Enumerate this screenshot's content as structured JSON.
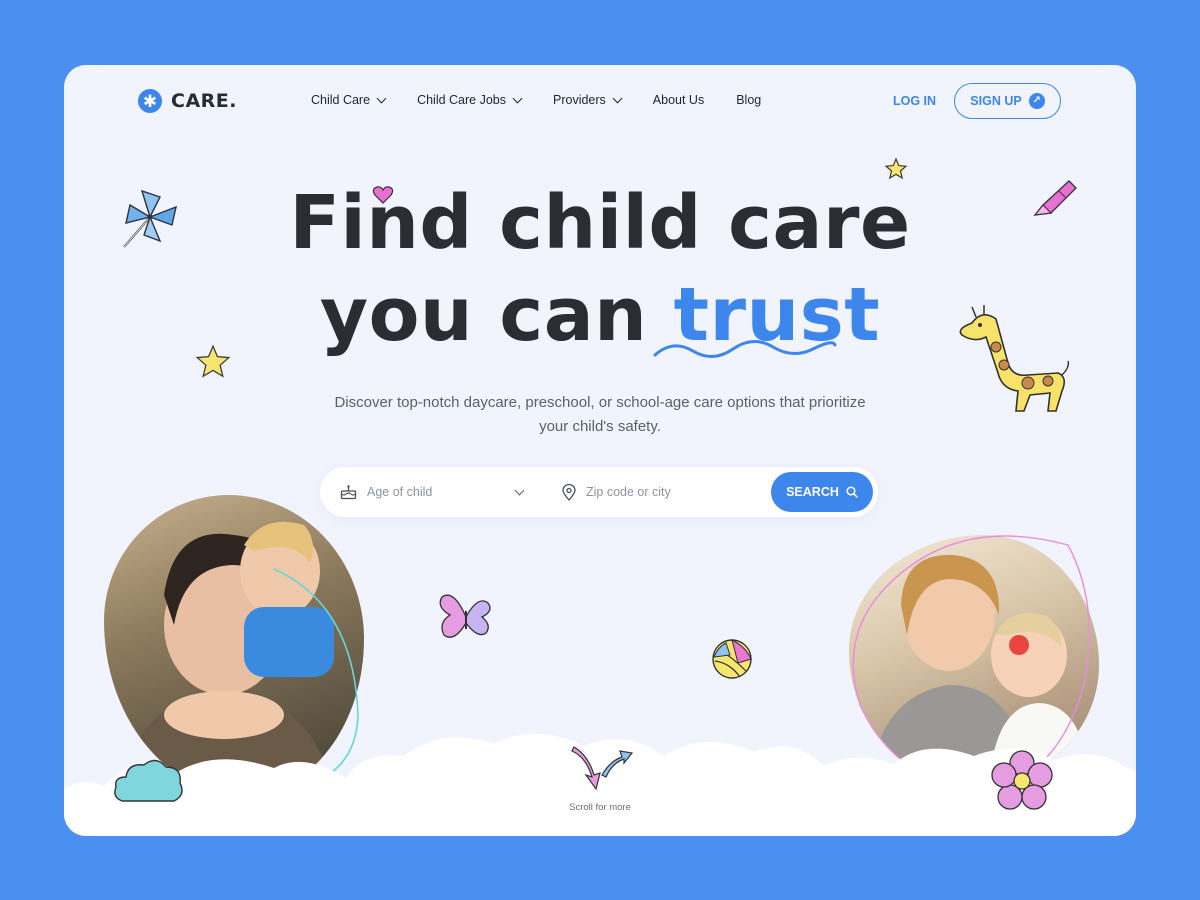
{
  "brand": {
    "name": "CARE."
  },
  "nav": {
    "items": [
      {
        "label": "Child Care",
        "has_dropdown": true
      },
      {
        "label": "Child Care Jobs",
        "has_dropdown": true
      },
      {
        "label": "Providers",
        "has_dropdown": true
      },
      {
        "label": "About Us",
        "has_dropdown": false
      },
      {
        "label": "Blog",
        "has_dropdown": false
      }
    ],
    "login_label": "LOG IN",
    "signup_label": "SIGN UP"
  },
  "hero": {
    "title_line1": "Find child care",
    "title_line2_plain": "you can",
    "title_line2_accent": "trust",
    "subtitle": "Discover top-notch daycare, preschool, or school-age care options that prioritize your child's safety."
  },
  "search": {
    "age_placeholder": "Age of child",
    "zip_placeholder": "Zip code or city",
    "button_label": "SEARCH"
  },
  "scroll_hint": "Scroll for more",
  "colors": {
    "background": "#4a90f0",
    "card": "#f1f4fd",
    "accent": "#3d86ec",
    "text": "#2a2d33"
  },
  "icons": [
    "asterisk-logo-icon",
    "chevron-down-icon",
    "arrow-up-right-icon",
    "cake-icon",
    "location-pin-icon",
    "search-icon",
    "pinwheel-icon",
    "crayon-icon",
    "giraffe-icon",
    "star-icon",
    "butterfly-icon",
    "ball-icon",
    "cloud-icon",
    "flower-icon",
    "arrows-icon",
    "heart-icon"
  ]
}
